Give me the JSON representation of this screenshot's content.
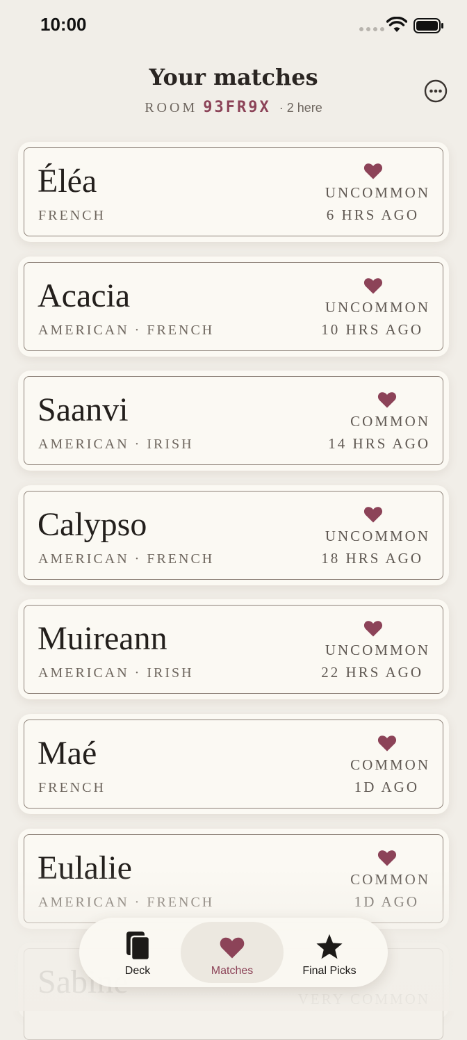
{
  "status_bar": {
    "time": "10:00"
  },
  "header": {
    "title": "Your matches",
    "room_label": "ROOM",
    "room_code": "93FR9X",
    "presence": "· 2 here"
  },
  "colors": {
    "accent": "#8c4358",
    "background": "#f1eee8",
    "card": "#fbf9f3"
  },
  "matches": [
    {
      "name": "Éléa",
      "origin": "FRENCH",
      "rarity": "UNCOMMON",
      "time": "6 HRS AGO"
    },
    {
      "name": "Acacia",
      "origin": "AMERICAN · FRENCH",
      "rarity": "UNCOMMON",
      "time": "10 HRS AGO"
    },
    {
      "name": "Saanvi",
      "origin": "AMERICAN · IRISH",
      "rarity": "COMMON",
      "time": "14 HRS AGO"
    },
    {
      "name": "Calypso",
      "origin": "AMERICAN · FRENCH",
      "rarity": "UNCOMMON",
      "time": "18 HRS AGO"
    },
    {
      "name": "Muireann",
      "origin": "AMERICAN · IRISH",
      "rarity": "UNCOMMON",
      "time": "22 HRS AGO"
    },
    {
      "name": "Maé",
      "origin": "FRENCH",
      "rarity": "COMMON",
      "time": "1D AGO"
    },
    {
      "name": "Eulalie",
      "origin": "AMERICAN · FRENCH",
      "rarity": "COMMON",
      "time": "1D AGO"
    },
    {
      "name": "Sabine",
      "origin": "",
      "rarity": "VERY COMMON",
      "time": ""
    }
  ],
  "tab_bar": {
    "tabs": [
      {
        "label": "Deck",
        "icon": "cards-icon"
      },
      {
        "label": "Matches",
        "icon": "heart-icon"
      },
      {
        "label": "Final Picks",
        "icon": "star-icon"
      }
    ],
    "active": "Matches"
  }
}
